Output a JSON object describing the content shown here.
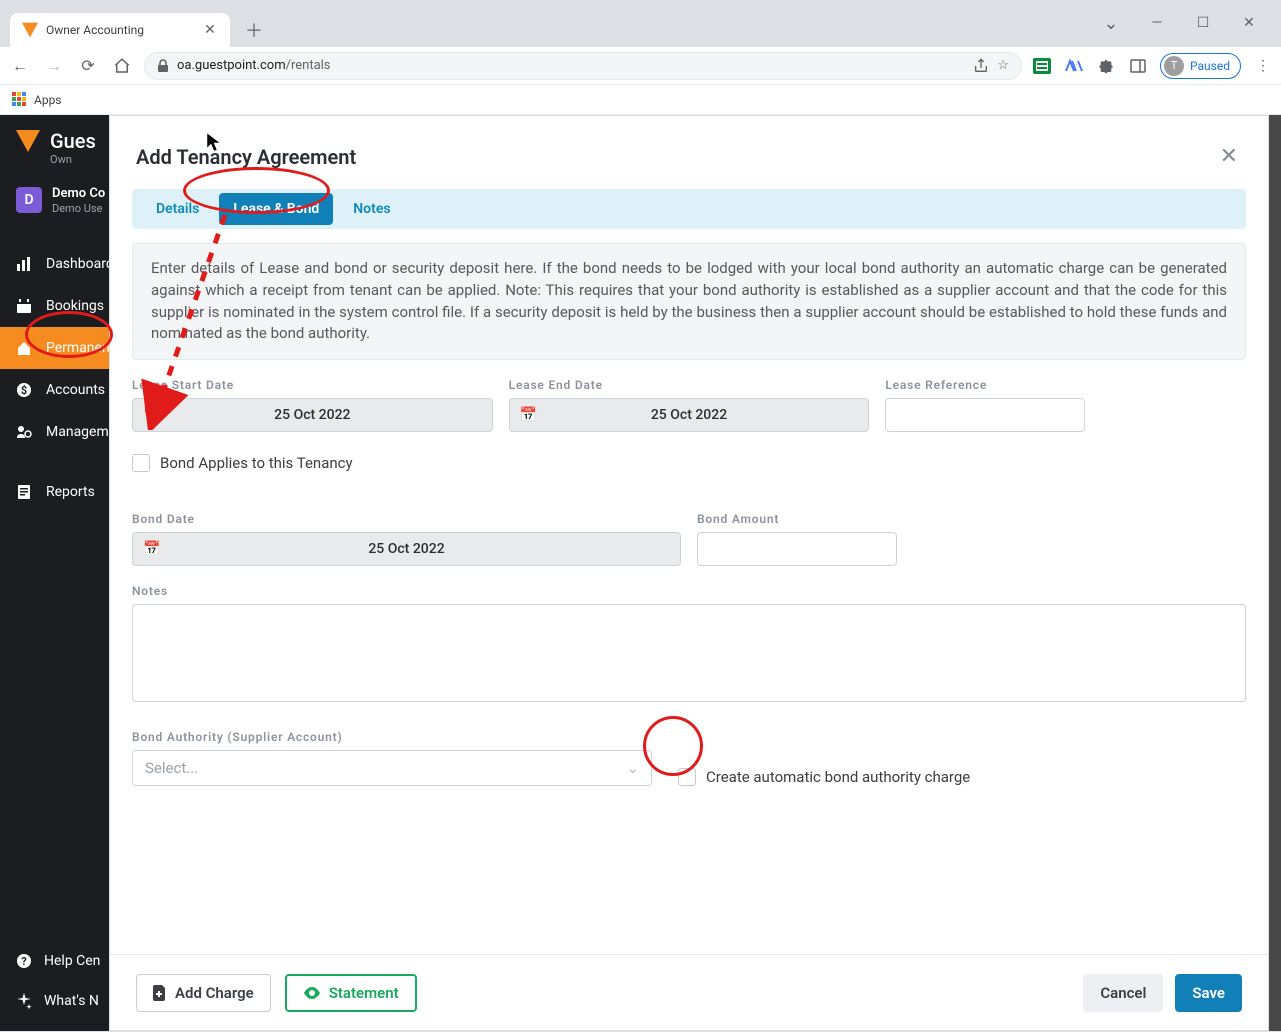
{
  "browser": {
    "tab_title": "Owner Accounting",
    "url_domain": "oa.guestpoint.com",
    "url_path": "/rentals",
    "bookmark_apps": "Apps",
    "paused_label": "Paused",
    "paused_initial": "T"
  },
  "sidebar": {
    "brand": "Gues",
    "subtitle": "Own",
    "user_initial": "D",
    "user_name": "Demo Co",
    "user_role": "Demo Use",
    "items": [
      {
        "label": "Dashboard"
      },
      {
        "label": "Bookings"
      },
      {
        "label": "Permanen"
      },
      {
        "label": "Accounts"
      },
      {
        "label": "Managem"
      },
      {
        "label": "Reports"
      }
    ],
    "bottom": [
      {
        "label": "Help Cen"
      },
      {
        "label": "What's N"
      }
    ]
  },
  "modal": {
    "title": "Add Tenancy Agreement",
    "tabs": {
      "details": "Details",
      "lease": "Lease & Bond",
      "notes": "Notes"
    },
    "info": "Enter details of Lease and bond or security deposit here. If the bond needs to be lodged with your local bond authority an automatic charge can be generated against which a receipt from tenant can be applied. Note: This requires that your bond authority is established as a supplier account and that the code for this supplier is nominated in the system control file. If a security deposit is held by the business then a supplier account should be established to hold these funds and nominated as the bond authority.",
    "labels": {
      "lease_start": "Lease Start Date",
      "lease_end": "Lease End Date",
      "lease_ref": "Lease Reference",
      "bond_applies": "Bond Applies to this Tenancy",
      "bond_date": "Bond Date",
      "bond_amount": "Bond Amount",
      "notes": "Notes",
      "bond_authority": "Bond Authority (Supplier Account)",
      "auto_charge": "Create automatic bond authority charge",
      "select_placeholder": "Select..."
    },
    "values": {
      "lease_start": "25 Oct 2022",
      "lease_end": "25 Oct 2022",
      "lease_ref": "",
      "bond_date": "25 Oct 2022",
      "bond_amount": "",
      "notes": ""
    },
    "footer": {
      "add_charge": "Add Charge",
      "statement": "Statement",
      "cancel": "Cancel",
      "save": "Save"
    }
  }
}
